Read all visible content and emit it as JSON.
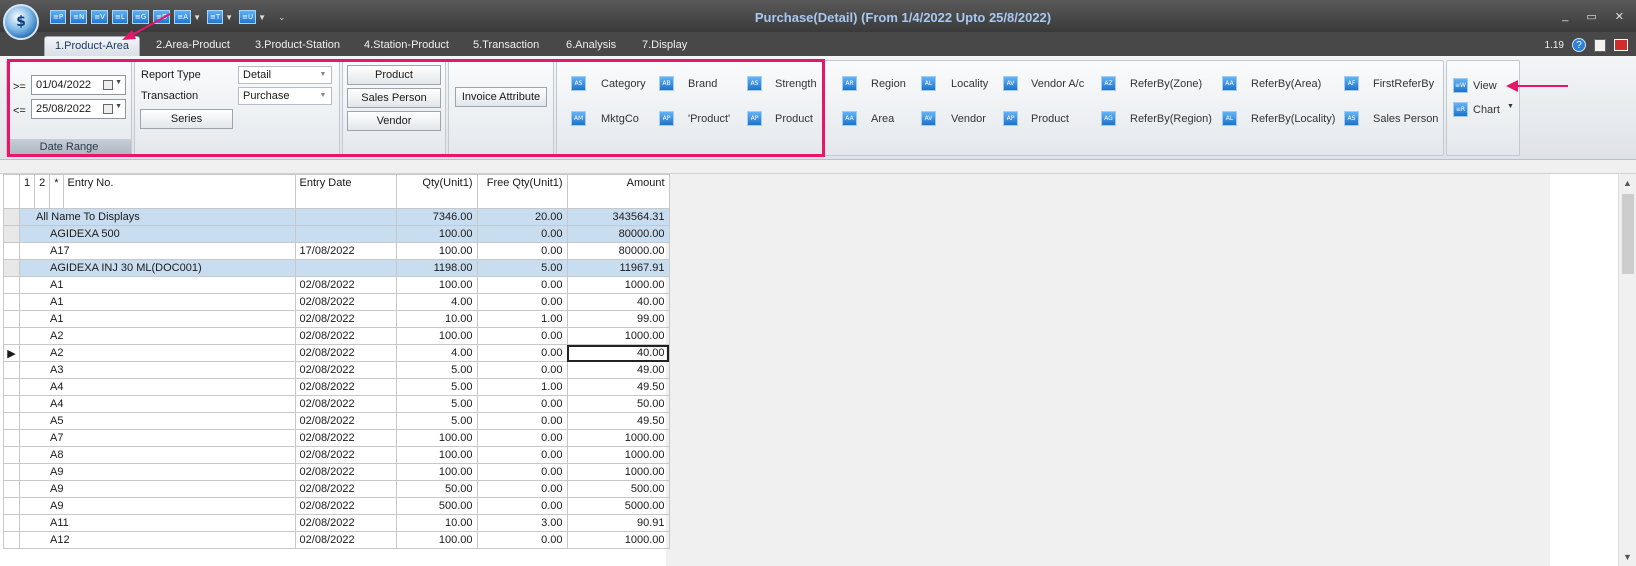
{
  "window": {
    "title": "Purchase(Detail) (From 1/4/2022 Upto 25/8/2022)",
    "logo_text": "$",
    "controls": [
      "_",
      "▭",
      "✕"
    ]
  },
  "quick_access": [
    {
      "code": "≡P"
    },
    {
      "code": "≡N"
    },
    {
      "code": "≡V"
    },
    {
      "code": "≡L"
    },
    {
      "code": "≡G"
    },
    {
      "code": "≡D"
    },
    {
      "code": "≡A"
    },
    {
      "code": "≡T"
    },
    {
      "code": "≡U"
    }
  ],
  "tabs": [
    "1.Product-Area",
    "2.Area-Product",
    "3.Product-Station",
    "4.Station-Product",
    "5.Transaction",
    "6.Analysis",
    "7.Display"
  ],
  "version": "1.19",
  "date_range": {
    "ge_label": ">=",
    "le_label": "<=",
    "from": "01/04/2022",
    "to": "25/08/2022",
    "caption": "Date Range"
  },
  "report": {
    "report_type_label": "Report Type",
    "report_type_value": "Detail",
    "transaction_label": "Transaction",
    "transaction_value": "Purchase",
    "series_button": "Series"
  },
  "entity_buttons": [
    "Product",
    "Sales Person",
    "Vendor"
  ],
  "invoice_attribute": "Invoice Attribute",
  "grouping": {
    "row1": [
      {
        "icon": "AS",
        "label": "Category"
      },
      {
        "icon": "AB",
        "label": "Brand"
      },
      {
        "icon": "AS",
        "label": "Strength"
      },
      {
        "icon": "AR",
        "label": "Region"
      },
      {
        "icon": "AL",
        "label": "Locality"
      },
      {
        "icon": "AV",
        "label": "Vendor A/c"
      },
      {
        "icon": "AZ",
        "label": "ReferBy(Zone)"
      },
      {
        "icon": "AA",
        "label": "ReferBy(Area)"
      },
      {
        "icon": "AF",
        "label": "FirstReferBy"
      }
    ],
    "row2": [
      {
        "icon": "AM",
        "label": "MktgCo"
      },
      {
        "icon": "AP",
        "label": "'Product'"
      },
      {
        "icon": "AP",
        "label": "Product"
      },
      {
        "icon": "AA",
        "label": "Area"
      },
      {
        "icon": "AV",
        "label": "Vendor"
      },
      {
        "icon": "AP",
        "label": "Product"
      },
      {
        "icon": "AG",
        "label": "ReferBy(Region)"
      },
      {
        "icon": "AL",
        "label": "ReferBy(Locality)"
      },
      {
        "icon": "AS",
        "label": "Sales Person"
      }
    ]
  },
  "view": {
    "view_label": "View",
    "chart_label": "Chart",
    "view_icon": "≡W",
    "chart_icon": "≡R"
  },
  "grid": {
    "headers": {
      "c1": "1",
      "c2": "2",
      "c3": "*",
      "entry_no": "Entry No.",
      "entry_date": "Entry Date",
      "qty": "Qty(Unit1)",
      "free_qty": "Free Qty(Unit1)",
      "amount": "Amount"
    },
    "rows": [
      {
        "level": 0,
        "group": true,
        "entry": "All Name To Displays",
        "date": "",
        "qty": "7346.00",
        "free": "20.00",
        "amount": "343564.31"
      },
      {
        "level": 1,
        "group": true,
        "entry": "AGIDEXA 500",
        "date": "",
        "qty": "100.00",
        "free": "0.00",
        "amount": "80000.00"
      },
      {
        "level": 2,
        "group": false,
        "entry": "A17",
        "date": "17/08/2022",
        "qty": "100.00",
        "free": "0.00",
        "amount": "80000.00"
      },
      {
        "level": 1,
        "group": true,
        "entry": "AGIDEXA INJ 30 ML(DOC001)",
        "date": "",
        "qty": "1198.00",
        "free": "5.00",
        "amount": "11967.91"
      },
      {
        "level": 2,
        "group": false,
        "entry": "A1",
        "date": "02/08/2022",
        "qty": "100.00",
        "free": "0.00",
        "amount": "1000.00"
      },
      {
        "level": 2,
        "group": false,
        "entry": "A1",
        "date": "02/08/2022",
        "qty": "4.00",
        "free": "0.00",
        "amount": "40.00"
      },
      {
        "level": 2,
        "group": false,
        "entry": "A1",
        "date": "02/08/2022",
        "qty": "10.00",
        "free": "1.00",
        "amount": "99.00"
      },
      {
        "level": 2,
        "group": false,
        "entry": "A2",
        "date": "02/08/2022",
        "qty": "100.00",
        "free": "0.00",
        "amount": "1000.00"
      },
      {
        "level": 2,
        "group": false,
        "entry": "A2",
        "date": "02/08/2022",
        "qty": "4.00",
        "free": "0.00",
        "amount": "40.00",
        "current": true
      },
      {
        "level": 2,
        "group": false,
        "entry": "A3",
        "date": "02/08/2022",
        "qty": "5.00",
        "free": "0.00",
        "amount": "49.00"
      },
      {
        "level": 2,
        "group": false,
        "entry": "A4",
        "date": "02/08/2022",
        "qty": "5.00",
        "free": "1.00",
        "amount": "49.50"
      },
      {
        "level": 2,
        "group": false,
        "entry": "A4",
        "date": "02/08/2022",
        "qty": "5.00",
        "free": "0.00",
        "amount": "50.00"
      },
      {
        "level": 2,
        "group": false,
        "entry": "A5",
        "date": "02/08/2022",
        "qty": "5.00",
        "free": "0.00",
        "amount": "49.50"
      },
      {
        "level": 2,
        "group": false,
        "entry": "A7",
        "date": "02/08/2022",
        "qty": "100.00",
        "free": "0.00",
        "amount": "1000.00"
      },
      {
        "level": 2,
        "group": false,
        "entry": "A8",
        "date": "02/08/2022",
        "qty": "100.00",
        "free": "0.00",
        "amount": "1000.00"
      },
      {
        "level": 2,
        "group": false,
        "entry": "A9",
        "date": "02/08/2022",
        "qty": "100.00",
        "free": "0.00",
        "amount": "1000.00"
      },
      {
        "level": 2,
        "group": false,
        "entry": "A9",
        "date": "02/08/2022",
        "qty": "50.00",
        "free": "0.00",
        "amount": "500.00"
      },
      {
        "level": 2,
        "group": false,
        "entry": "A9",
        "date": "02/08/2022",
        "qty": "500.00",
        "free": "0.00",
        "amount": "5000.00"
      },
      {
        "level": 2,
        "group": false,
        "entry": "A11",
        "date": "02/08/2022",
        "qty": "10.00",
        "free": "3.00",
        "amount": "90.91"
      },
      {
        "level": 2,
        "group": false,
        "entry": "A12",
        "date": "02/08/2022",
        "qty": "100.00",
        "free": "0.00",
        "amount": "1000.00"
      }
    ]
  },
  "colors": {
    "highlight": "#e6176b",
    "group_row": "#c9ddf1",
    "title_text": "#a8c8f0"
  }
}
